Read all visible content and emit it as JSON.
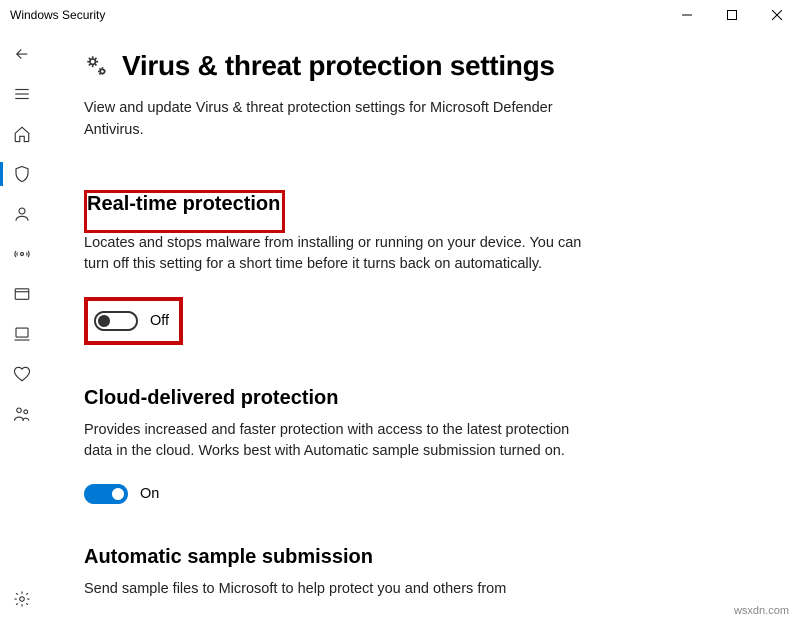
{
  "window": {
    "title": "Windows Security"
  },
  "page": {
    "title": "Virus & threat protection settings",
    "description": "View and update Virus & threat protection settings for Microsoft Defender Antivirus."
  },
  "sections": {
    "realtime": {
      "title": "Real-time protection",
      "description": "Locates and stops malware from installing or running on your device. You can turn off this setting for a short time before it turns back on automatically.",
      "toggle_state": "Off"
    },
    "cloud": {
      "title": "Cloud-delivered protection",
      "description": "Provides increased and faster protection with access to the latest protection data in the cloud. Works best with Automatic sample submission turned on.",
      "toggle_state": "On"
    },
    "sample": {
      "title": "Automatic sample submission",
      "description": "Send sample files to Microsoft to help protect you and others from"
    }
  },
  "watermark": "wsxdn.com"
}
